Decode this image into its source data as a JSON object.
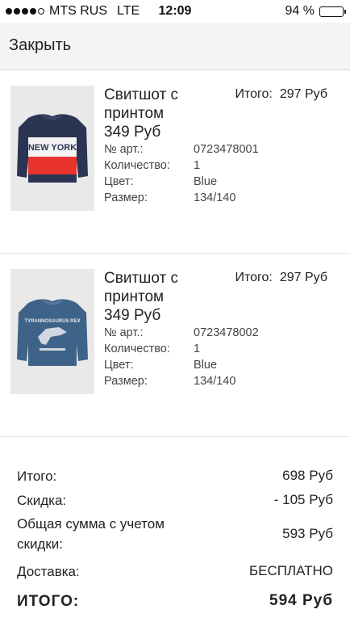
{
  "status_bar": {
    "carrier": "MTS RUS",
    "network": "LTE",
    "time": "12:09",
    "battery": "94 %",
    "battery_level": 0.94
  },
  "header": {
    "close_label": "Закрыть"
  },
  "items": [
    {
      "title": "Свитшот с принтом",
      "price": "349 Руб",
      "total_label": "Итого:",
      "total_value": "297 Руб",
      "details": [
        {
          "k": "№ арт.:",
          "v": "0723478001"
        },
        {
          "k": "Количество:",
          "v": "1"
        },
        {
          "k": "Цвет:",
          "v": "Blue"
        },
        {
          "k": "Размер:",
          "v": "134/140"
        }
      ],
      "print_text": "NEW YORK"
    },
    {
      "title": "Свитшот с принтом",
      "price": "349 Руб",
      "total_label": "Итого:",
      "total_value": "297 Руб",
      "details": [
        {
          "k": "№ арт.:",
          "v": "0723478002"
        },
        {
          "k": "Количество:",
          "v": "1"
        },
        {
          "k": "Цвет:",
          "v": "Blue"
        },
        {
          "k": "Размер:",
          "v": "134/140"
        }
      ],
      "print_text": "TYRANNOSAURUS REX"
    }
  ],
  "summary": {
    "subtotal_label": "Итого:",
    "subtotal_value": "698 Руб",
    "discount_label": "Скидка:",
    "discount_value": "- 105 Руб",
    "discounted_label": "Общая сумма с учетом скидки:",
    "discounted_value": "593 Руб",
    "delivery_label": "Доставка:",
    "delivery_value": "БЕСПЛАТНО",
    "grand_label": "ИТОГО:",
    "grand_value": "594 Руб"
  }
}
